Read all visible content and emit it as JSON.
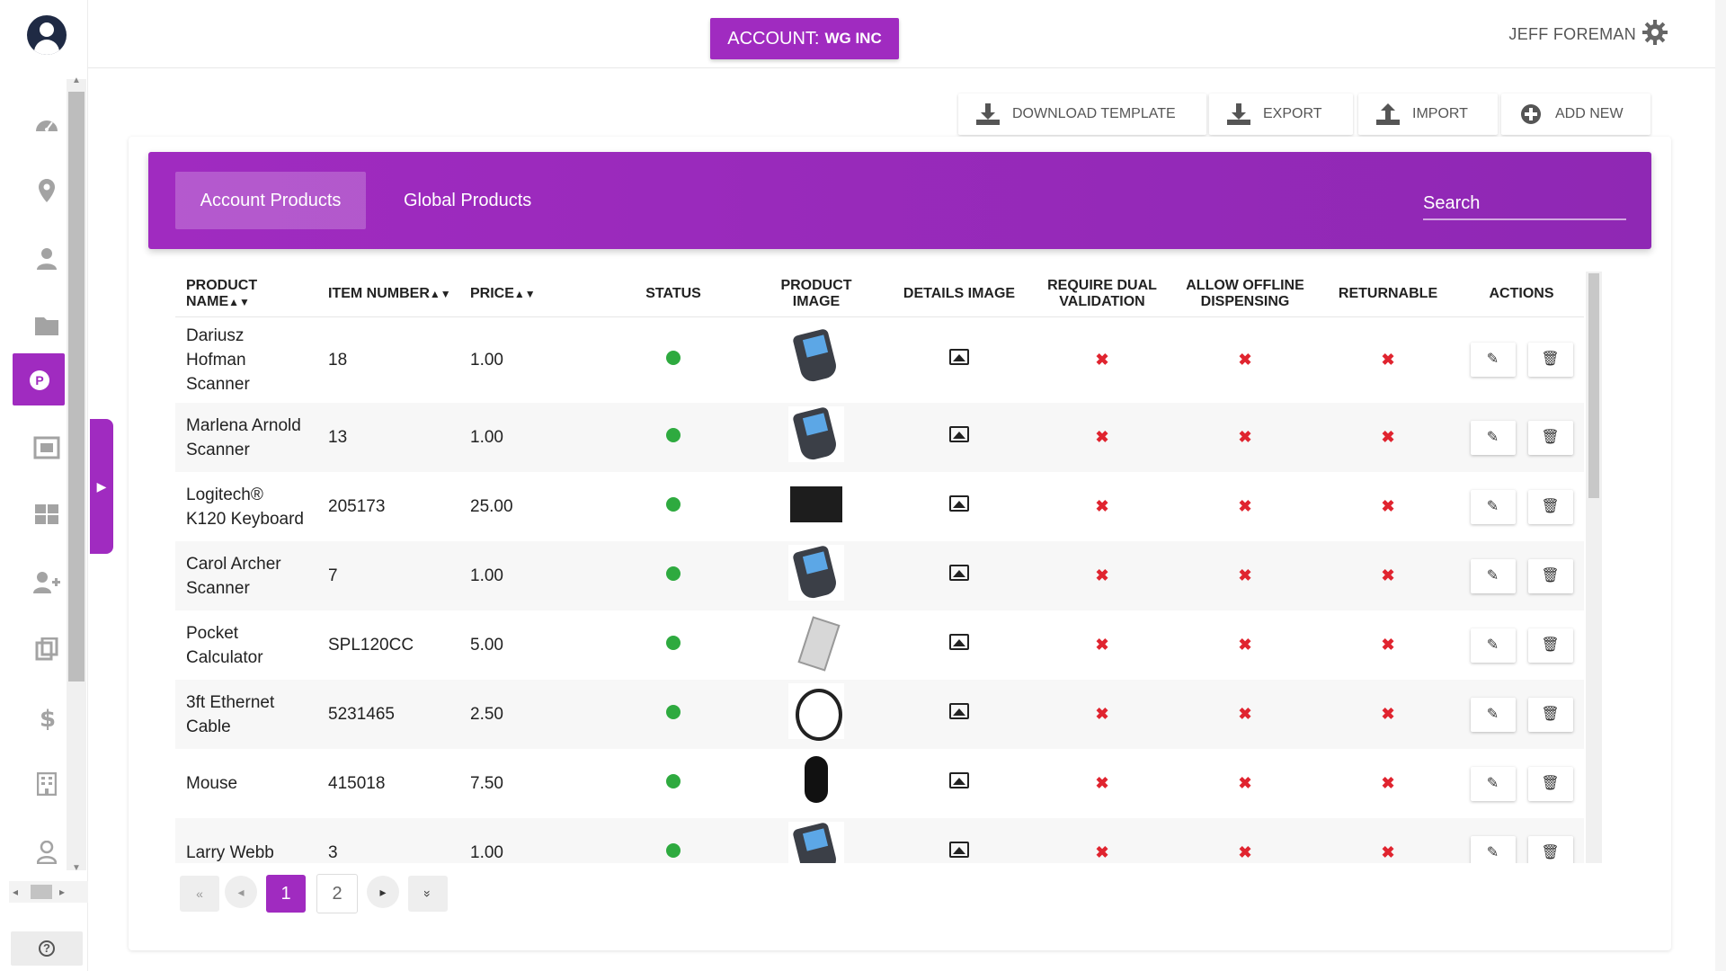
{
  "header": {
    "account_prefix": "ACCOUNT:",
    "account_name": "WG INC",
    "user_name": "JEFF FOREMAN"
  },
  "toolbar": {
    "download_template": "DOWNLOAD TEMPLATE",
    "export": "EXPORT",
    "import": "IMPORT",
    "add_new": "ADD NEW"
  },
  "tabs": {
    "account_products": "Account Products",
    "global_products": "Global Products"
  },
  "search": {
    "placeholder": "Search"
  },
  "table": {
    "headers": {
      "product_name_1": "PRODUCT",
      "product_name_2": "NAME",
      "item_number": "ITEM NUMBER",
      "price": "PRICE",
      "status": "STATUS",
      "product_image_1": "PRODUCT",
      "product_image_2": "IMAGE",
      "details_image": "DETAILS IMAGE",
      "require_dual_1": "REQUIRE DUAL",
      "require_dual_2": "VALIDATION",
      "allow_offline_1": "ALLOW OFFLINE",
      "allow_offline_2": "DISPENSING",
      "returnable": "RETURNABLE",
      "actions": "ACTIONS"
    },
    "rows": [
      {
        "name_1": "Dariusz",
        "name_2": "Hofman",
        "name_3": "Scanner",
        "item": "18",
        "price": "1.00",
        "image": "scanner"
      },
      {
        "name_1": "Marlena Arnold",
        "name_2": "Scanner",
        "item": "13",
        "price": "1.00",
        "image": "scanner"
      },
      {
        "name_1": "Logitech®",
        "name_2": "K120 Keyboard",
        "item": "205173",
        "price": "25.00",
        "image": "keyboard"
      },
      {
        "name_1": "Carol Archer",
        "name_2": "Scanner",
        "item": "7",
        "price": "1.00",
        "image": "scanner"
      },
      {
        "name_1": "Pocket",
        "name_2": "Calculator",
        "item": "SPL120CC",
        "price": "5.00",
        "image": "calculator"
      },
      {
        "name_1": "3ft Ethernet",
        "name_2": "Cable",
        "item": "5231465",
        "price": "2.50",
        "image": "cable"
      },
      {
        "name_1": "Mouse",
        "item": "415018",
        "price": "7.50",
        "image": "mouse"
      },
      {
        "name_1": "Larry Webb",
        "item": "3",
        "price": "1.00",
        "image": "scanner"
      }
    ],
    "cross": "✖"
  },
  "pagination": {
    "first": "«",
    "prev": "◂",
    "current": "1",
    "page2": "2",
    "next": "▸",
    "last": "»"
  },
  "sidebar": {
    "active_label": "P",
    "help_label": "?"
  },
  "colors": {
    "brand_purple": "#a02bc0",
    "status_green": "#2eaa3f",
    "cross_red": "#e0242f"
  }
}
